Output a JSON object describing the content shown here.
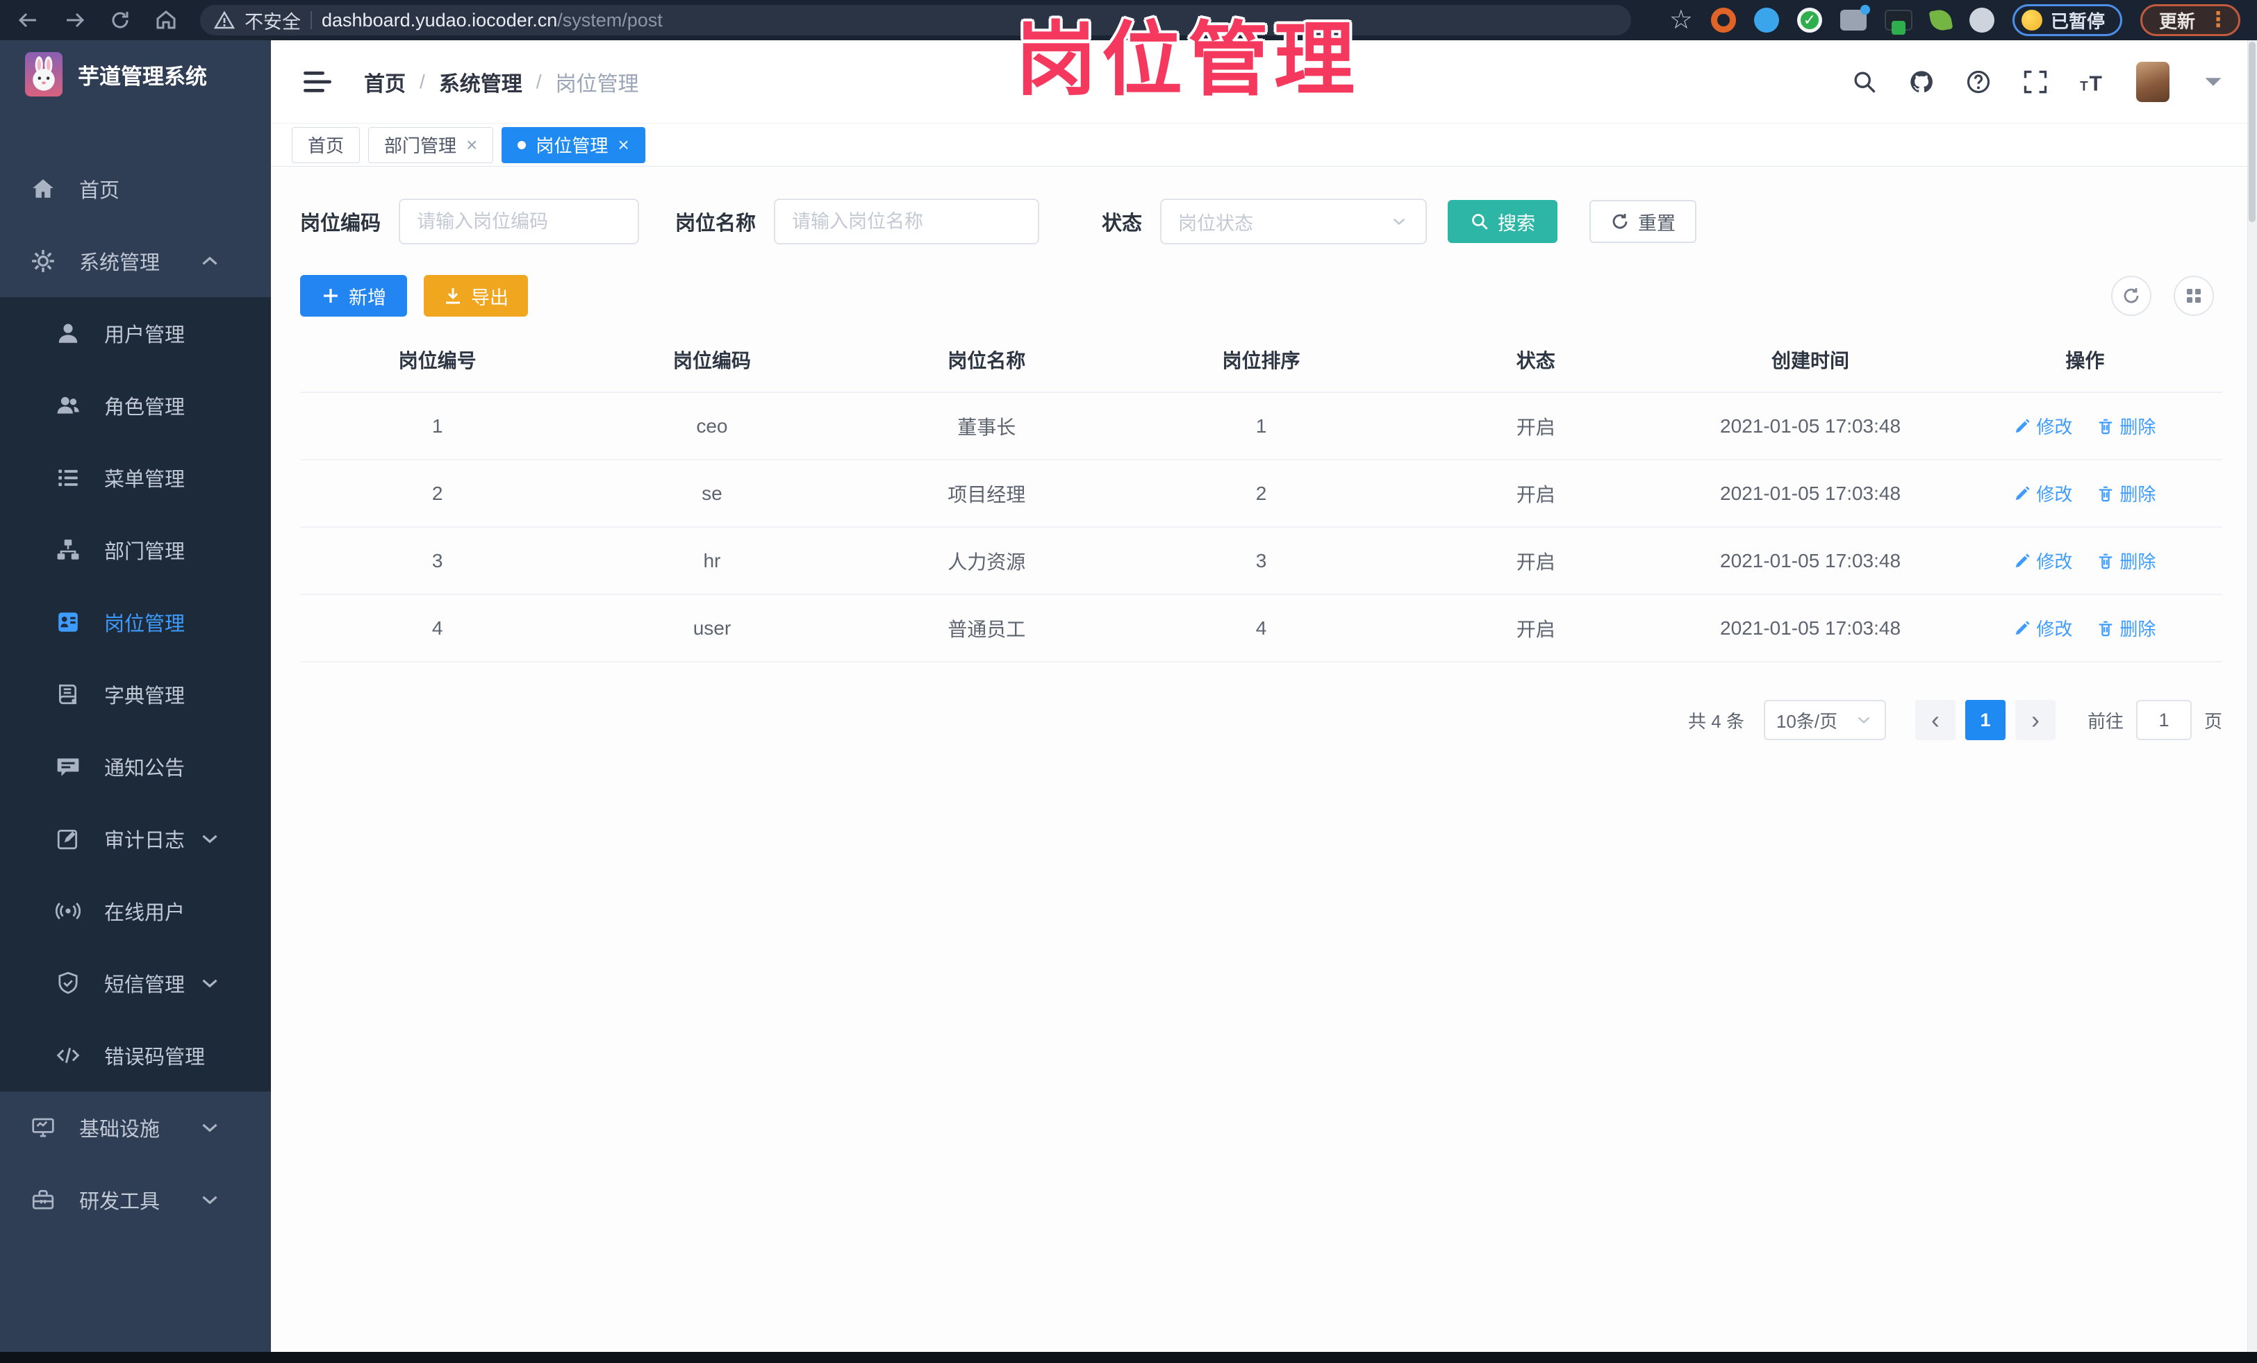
{
  "browser": {
    "security_label": "不安全",
    "url_host": "dashboard.yudao.iocoder.cn",
    "url_path": "/system/post",
    "paused_badge": "已暂停",
    "update_label": "更新"
  },
  "watermark": "岗位管理",
  "sidebar": {
    "app_title": "芋道管理系统",
    "items": [
      {
        "key": "home",
        "label": "首页",
        "icon": "home",
        "level": 1
      },
      {
        "key": "system",
        "label": "系统管理",
        "icon": "gear",
        "level": 1,
        "chevron": "up",
        "expanded": true
      },
      {
        "key": "user",
        "label": "用户管理",
        "icon": "user",
        "level": 2
      },
      {
        "key": "role",
        "label": "角色管理",
        "icon": "users",
        "level": 2
      },
      {
        "key": "menu",
        "label": "菜单管理",
        "icon": "list",
        "level": 2
      },
      {
        "key": "dept",
        "label": "部门管理",
        "icon": "tree",
        "level": 2
      },
      {
        "key": "post",
        "label": "岗位管理",
        "icon": "badge",
        "level": 2,
        "active": true
      },
      {
        "key": "dict",
        "label": "字典管理",
        "icon": "book",
        "level": 2
      },
      {
        "key": "notice",
        "label": "通知公告",
        "icon": "message",
        "level": 2
      },
      {
        "key": "auditlog",
        "label": "审计日志",
        "icon": "editlog",
        "level": 2,
        "chevron": "down"
      },
      {
        "key": "online",
        "label": "在线用户",
        "icon": "broadcast",
        "level": 2
      },
      {
        "key": "sms",
        "label": "短信管理",
        "icon": "shield",
        "level": 2,
        "chevron": "down"
      },
      {
        "key": "errcode",
        "label": "错误码管理",
        "icon": "code",
        "level": 2
      },
      {
        "key": "infra",
        "label": "基础设施",
        "icon": "monitor",
        "level": 1,
        "chevron": "down"
      },
      {
        "key": "devtool",
        "label": "研发工具",
        "icon": "toolbox",
        "level": 1,
        "chevron": "down"
      }
    ]
  },
  "header": {
    "breadcrumb": [
      {
        "label": "首页"
      },
      {
        "label": "系统管理"
      },
      {
        "label": "岗位管理",
        "current": true
      }
    ]
  },
  "tabs": [
    {
      "key": "home",
      "label": "首页",
      "closable": false,
      "active": false
    },
    {
      "key": "dept",
      "label": "部门管理",
      "closable": true,
      "active": false
    },
    {
      "key": "post",
      "label": "岗位管理",
      "closable": true,
      "active": true
    }
  ],
  "filters": {
    "code_label": "岗位编码",
    "code_placeholder": "请输入岗位编码",
    "name_label": "岗位名称",
    "name_placeholder": "请输入岗位名称",
    "status_label": "状态",
    "status_placeholder": "岗位状态",
    "search_label": "搜索",
    "reset_label": "重置"
  },
  "toolbar": {
    "add_label": "新增",
    "export_label": "导出"
  },
  "table": {
    "columns": [
      "岗位编号",
      "岗位编码",
      "岗位名称",
      "岗位排序",
      "状态",
      "创建时间",
      "操作"
    ],
    "rows": [
      {
        "id": "1",
        "code": "ceo",
        "name": "董事长",
        "sort": "1",
        "status": "开启",
        "created": "2021-01-05 17:03:48"
      },
      {
        "id": "2",
        "code": "se",
        "name": "项目经理",
        "sort": "2",
        "status": "开启",
        "created": "2021-01-05 17:03:48"
      },
      {
        "id": "3",
        "code": "hr",
        "name": "人力资源",
        "sort": "3",
        "status": "开启",
        "created": "2021-01-05 17:03:48"
      },
      {
        "id": "4",
        "code": "user",
        "name": "普通员工",
        "sort": "4",
        "status": "开启",
        "created": "2021-01-05 17:03:48"
      }
    ],
    "edit_label": "修改",
    "delete_label": "删除"
  },
  "pagination": {
    "total_label": "共 4 条",
    "page_size": "10条/页",
    "current_page": "1",
    "goto_label": "前往",
    "goto_value": "1",
    "unit_label": "页"
  },
  "colors": {
    "accent_blue": "#1f8bf2",
    "link_blue": "#3f9cff",
    "search_teal": "#2db5a5",
    "export_yellow": "#f0a71f",
    "watermark_pink": "#f5395e",
    "sidebar_bg": "#2f3d55",
    "submenu_bg": "#1d2a3a"
  }
}
